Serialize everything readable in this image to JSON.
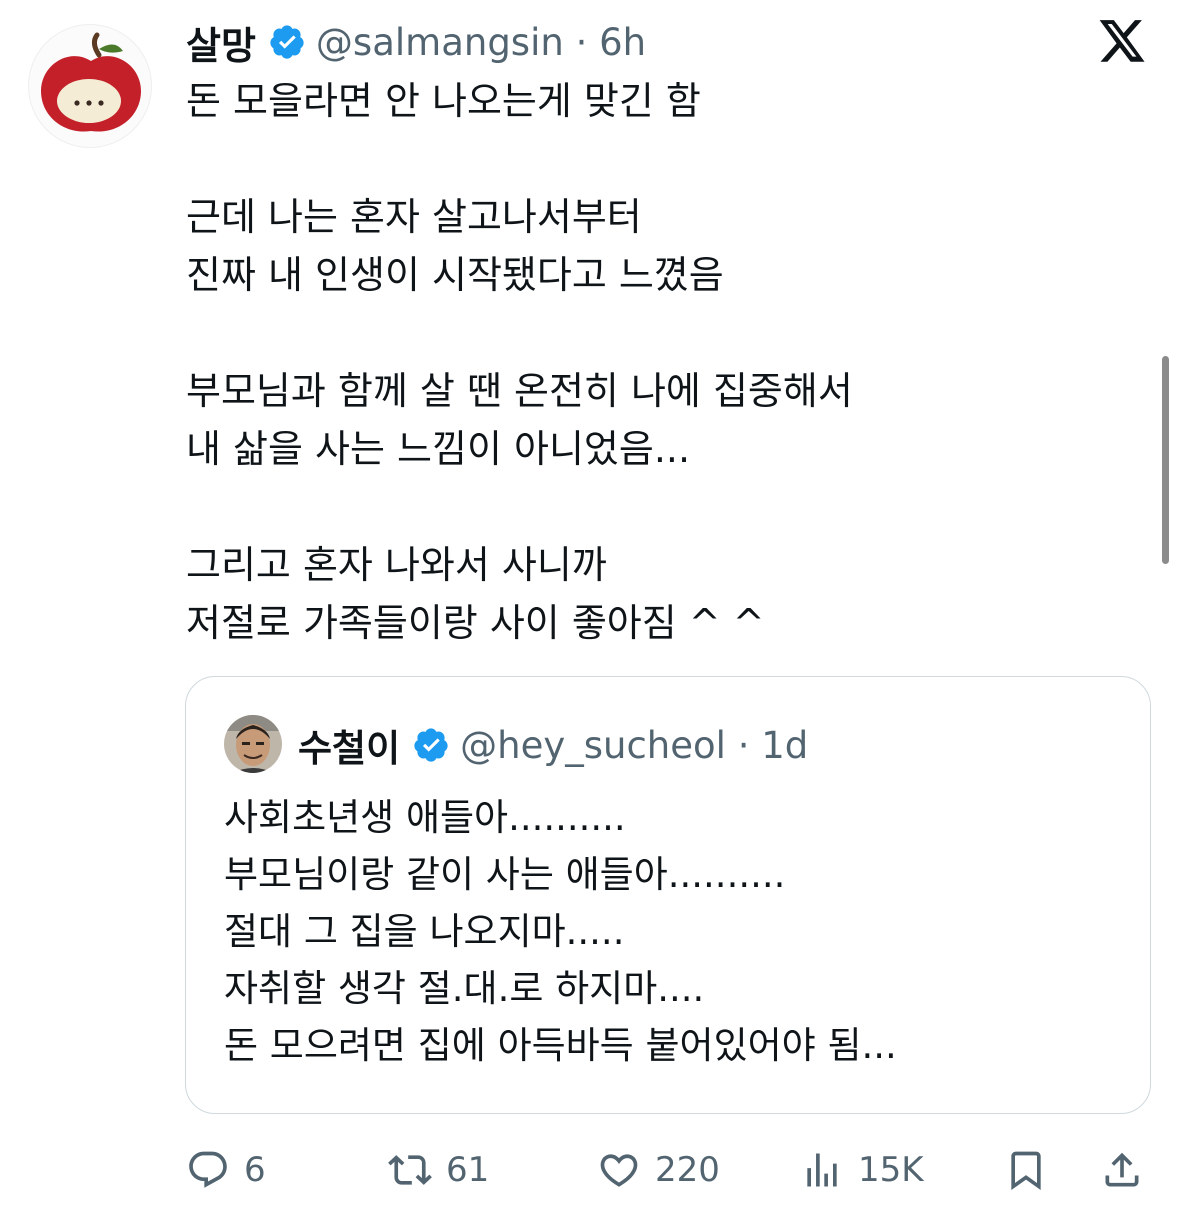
{
  "tweet": {
    "author_name": "살망",
    "author_handle": "@salmangsin",
    "time": "6h",
    "lines": [
      "돈 모을라면 안 나오는게 맞긴 함",
      "",
      "근데 나는 혼자 살고나서부터",
      "진짜 내 인생이 시작됐다고 느꼈음",
      "",
      "부모님과 함께 살 땐 온전히 나에 집중해서",
      "내 삶을 사는 느낌이 아니었음...",
      "",
      "그리고 혼자 나와서 사니까",
      "저절로 가족들이랑 사이 좋아짐 ^ ^"
    ]
  },
  "quote": {
    "author_name": "수철이",
    "author_handle": "@hey_sucheol",
    "time": "1d",
    "lines": [
      "사회초년생 애들아..........",
      "부모님이랑 같이 사는 애들아..........",
      "절대 그 집을 나오지마.....",
      "자취할 생각 절.대.로 하지마....",
      "돈 모으려면 집에 아득바득 붙어있어야 됨..."
    ]
  },
  "actions": {
    "replies": "6",
    "reposts": "61",
    "likes": "220",
    "views": "15K"
  },
  "icons": {
    "verified": "verified-badge-icon",
    "logo": "x-logo-icon",
    "reply": "reply-icon",
    "repost": "repost-icon",
    "like": "heart-icon",
    "views": "views-icon",
    "bookmark": "bookmark-icon",
    "share": "share-icon"
  },
  "colors": {
    "verified": "#1d9bf0",
    "text": "#0f1419",
    "secondary": "#536471",
    "border": "#cfd9de"
  }
}
